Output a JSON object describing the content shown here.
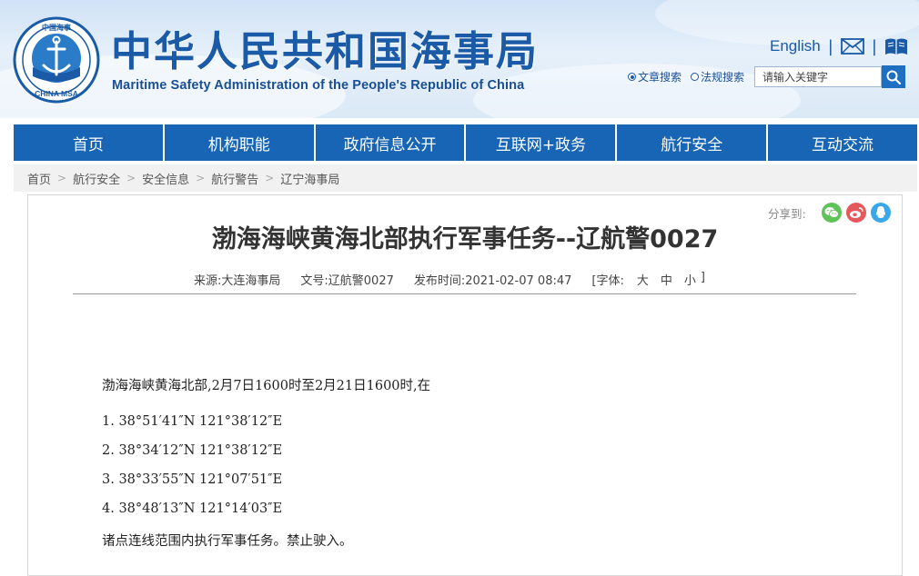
{
  "header": {
    "title": "中华人民共和国海事局",
    "subtitle": "Maritime Safety Administration of the People's Republic of China",
    "logo_text_top": "中国海事",
    "logo_text_bottom": "CHINA MSA",
    "english_link": "English",
    "separator": "|",
    "search": {
      "options": [
        {
          "label": "文章搜索",
          "selected": true
        },
        {
          "label": "法规搜索",
          "selected": false
        }
      ],
      "placeholder": "请输入关键字"
    }
  },
  "nav": {
    "items": [
      "首页",
      "机构职能",
      "政府信息公开",
      "互联网+政务",
      "航行安全",
      "互动交流"
    ]
  },
  "breadcrumb": {
    "separator": ">",
    "items": [
      "首页",
      "航行安全",
      "安全信息",
      "航行警告",
      "辽宁海事局"
    ]
  },
  "article": {
    "share_label": "分享到:",
    "title": "渤海海峡黄海北部执行军事任务--辽航警0027",
    "meta": {
      "source": "来源:大连海事局",
      "doc_no": "文号:辽航警0027",
      "published": "发布时间:2021-02-07 08:47",
      "font_label": "[字体:",
      "font_large": "大",
      "font_medium": "中",
      "font_small": "小",
      "font_close": "]"
    },
    "intro": "渤海海峡黄海北部,2月7日1600时至2月21日1600时,在",
    "points": [
      "1. 38°51′41″N 121°38′12″E",
      "2. 38°34′12″N 121°38′12″E",
      "3. 38°33′55″N 121°07′51″E",
      "4. 38°48′13″N 121°14′03″E"
    ],
    "closing": "诸点连线范围内执行军事任务。禁止驶入。"
  },
  "colors": {
    "brand_blue": "#1765b4",
    "title_blue": "#1a5aa6",
    "wechat": "#5fc35a",
    "weibo": "#e5585b",
    "qq": "#3aa7e8"
  }
}
